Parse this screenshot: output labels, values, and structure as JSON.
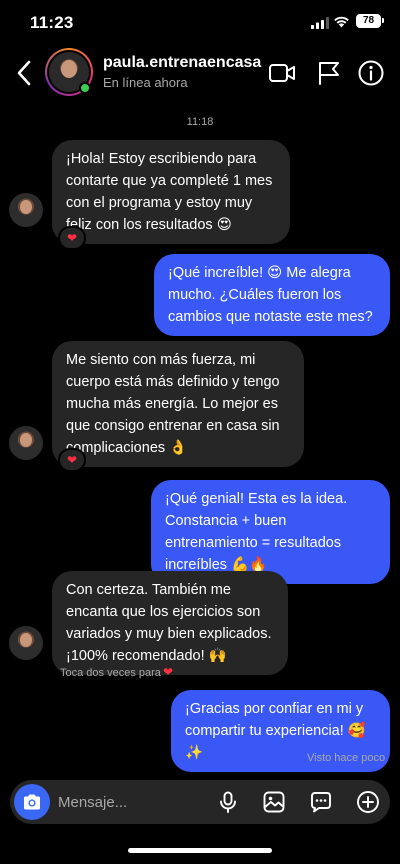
{
  "status_bar": {
    "time": "11:23",
    "battery": "78"
  },
  "header": {
    "username": "paula.entrenaencasa",
    "status": "En línea ahora",
    "icons": [
      "back-icon",
      "video-call-icon",
      "flag-icon",
      "info-icon"
    ]
  },
  "chat": {
    "timestamp": "11:18",
    "messages": [
      {
        "from": "them",
        "text": "¡Hola! Estoy escribiendo para contarte que ya completé 1 mes con el programa y estoy muy feliz con los resultados 😍",
        "reaction": "❤"
      },
      {
        "from": "me",
        "text": "¡Qué increíble! 😍 Me alegra mucho. ¿Cuáles fueron los cambios que notaste este mes?"
      },
      {
        "from": "them",
        "text": "Me siento con más fuerza, mi cuerpo está más definido y tengo mucha más energía. Lo mejor es que consigo entrenar en casa sin complicaciones 👌",
        "reaction": "❤"
      },
      {
        "from": "me",
        "text": "¡Qué genial! Esta es la idea. Constancia + buen entrenamiento = resultados increíbles 💪🔥"
      },
      {
        "from": "them",
        "text": "Con certeza. También me encanta que los ejercicios son variados y muy bien explicados. ¡100% recomendado! 🙌"
      },
      {
        "from": "me",
        "text": "¡Gracias por confiar en mi y compartir tu experiencia! 🥰✨"
      }
    ],
    "double_tap_hint": "Toca dos veces para",
    "double_tap_heart": "❤",
    "seen": "Visto hace poco"
  },
  "composer": {
    "placeholder": "Mensaje...",
    "icons": [
      "camera-icon",
      "microphone-icon",
      "gallery-icon",
      "sticker-icon",
      "plus-icon"
    ]
  },
  "colors": {
    "outgoing_bubble": "#3a58f5",
    "incoming_bubble": "#262626",
    "camera_button": "#3a68f5",
    "online": "#3ccf4e"
  }
}
